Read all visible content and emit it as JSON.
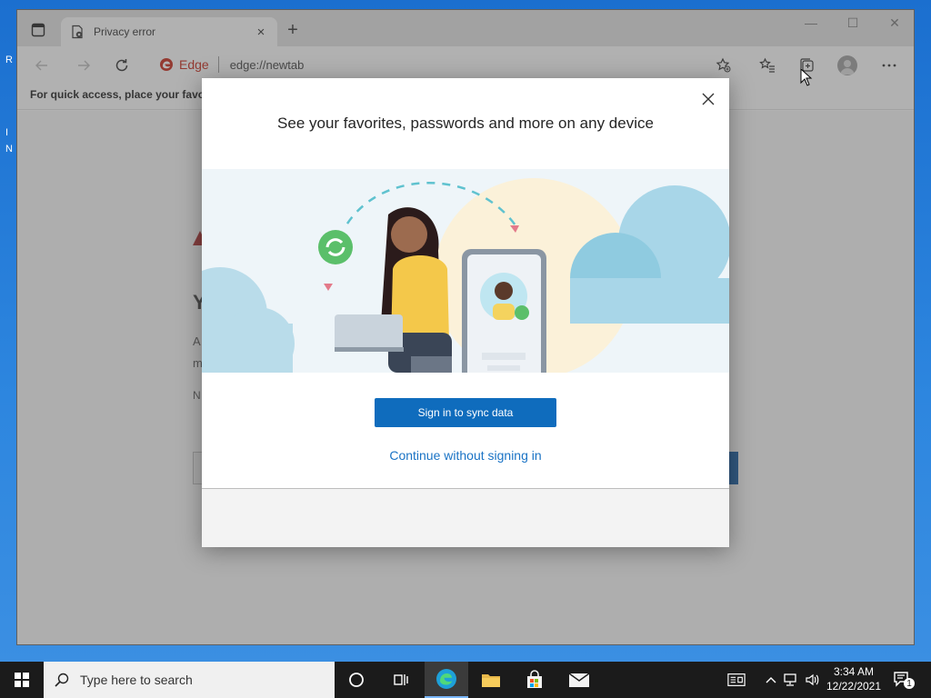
{
  "desktop": {
    "edge_letters": [
      "R",
      "I",
      "N"
    ]
  },
  "browser": {
    "tab": {
      "title": "Privacy error",
      "close_glyph": "×"
    },
    "new_tab_glyph": "+",
    "window_controls": {
      "minimize": "—",
      "maximize": "☐",
      "close": "✕"
    },
    "address_bar": {
      "brand": "Edge",
      "url": "edge://newtab"
    },
    "favorites_bar_text": "For quick access, place your favorit",
    "background_page": {
      "heading_letter": "Y",
      "line1_letter": "A",
      "line2_letter": "m",
      "line3_letter": "N"
    }
  },
  "modal": {
    "title": "See your favorites, passwords and more on any device",
    "primary_button": "Sign in to sync data",
    "secondary_link": "Continue without signing in"
  },
  "taskbar": {
    "search_placeholder": "Type here to search",
    "clock": {
      "time": "3:34 AM",
      "date": "12/22/2021"
    },
    "notification_count": "1"
  },
  "colors": {
    "accent": "#0f6cbd",
    "link": "#1a73c5",
    "edge_red": "#c42b1c"
  }
}
